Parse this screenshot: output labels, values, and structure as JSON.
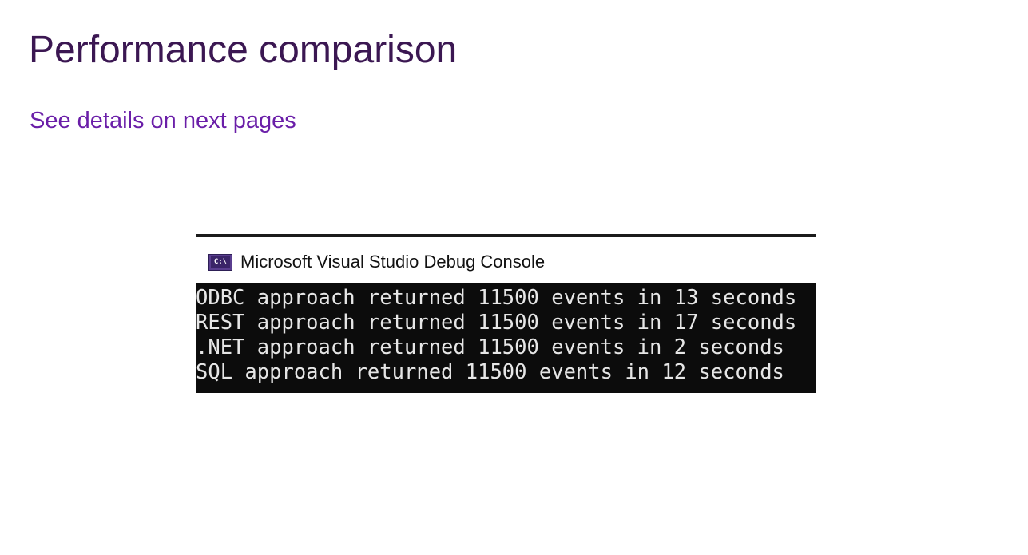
{
  "slide": {
    "title": "Performance comparison",
    "subtitle": "See details on next pages"
  },
  "console": {
    "icon": "console-app-icon",
    "icon_text": "C:\\",
    "window_title": "Microsoft Visual Studio Debug Console",
    "lines": [
      "ODBC approach returned 11500 events in 13 seconds",
      "REST approach returned 11500 events in 17 seconds",
      ".NET approach returned 11500 events in 2 seconds",
      "SQL approach returned 11500 events in 12 seconds"
    ]
  },
  "colors": {
    "title": "#3b1752",
    "subtitle": "#6a1ea8",
    "console_background": "#0c0c0c",
    "console_text": "#e6e6e6"
  }
}
